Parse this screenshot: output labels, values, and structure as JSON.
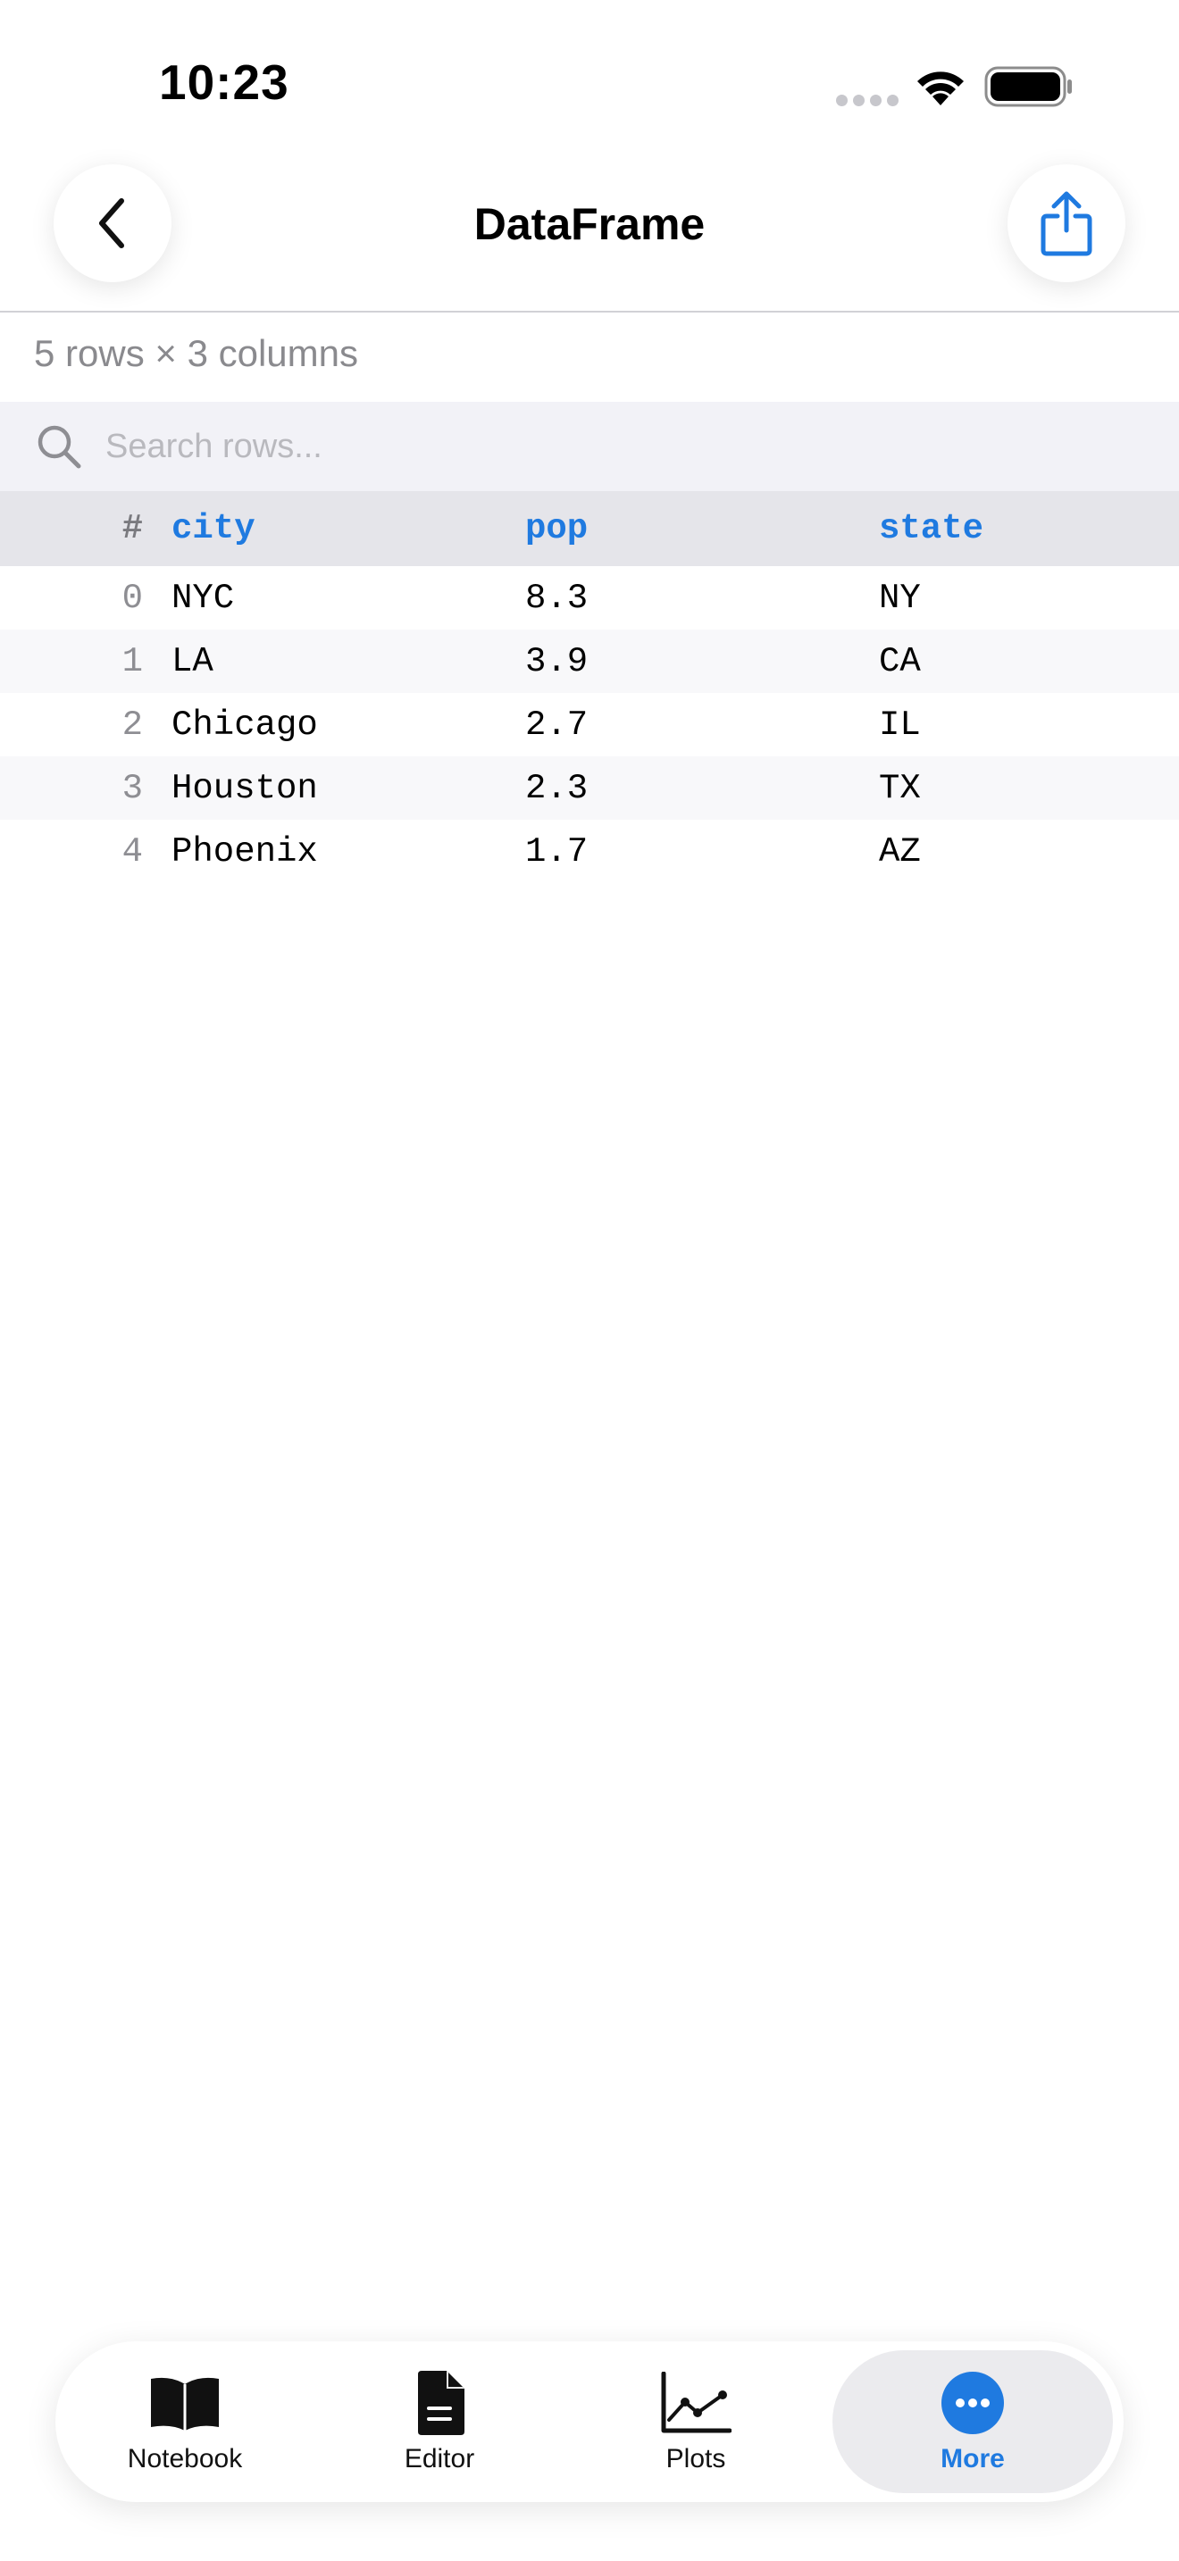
{
  "status_bar": {
    "time": "10:23"
  },
  "nav": {
    "title": "DataFrame",
    "back_icon": "chevron-left-icon",
    "share_icon": "share-icon"
  },
  "summary": "5 rows × 3 columns",
  "search": {
    "placeholder": "Search rows..."
  },
  "table": {
    "columns": {
      "index": "#",
      "city": "city",
      "pop": "pop",
      "state": "state"
    },
    "rows": [
      {
        "index": "0",
        "city": "NYC",
        "pop": "8.3",
        "state": "NY"
      },
      {
        "index": "1",
        "city": "LA",
        "pop": "3.9",
        "state": "CA"
      },
      {
        "index": "2",
        "city": "Chicago",
        "pop": "2.7",
        "state": "IL"
      },
      {
        "index": "3",
        "city": "Houston",
        "pop": "2.3",
        "state": "TX"
      },
      {
        "index": "4",
        "city": "Phoenix",
        "pop": "1.7",
        "state": "AZ"
      }
    ]
  },
  "tab_bar": {
    "tabs": [
      {
        "label": "Notebook",
        "icon": "book-icon"
      },
      {
        "label": "Editor",
        "icon": "document-icon"
      },
      {
        "label": "Plots",
        "icon": "line-chart-icon"
      },
      {
        "label": "More",
        "icon": "ellipsis-icon",
        "selected": true
      }
    ]
  },
  "colors": {
    "accent": "#1f7ae0",
    "header_bg": "#e5e5ea",
    "search_bg": "#f2f2f7"
  }
}
